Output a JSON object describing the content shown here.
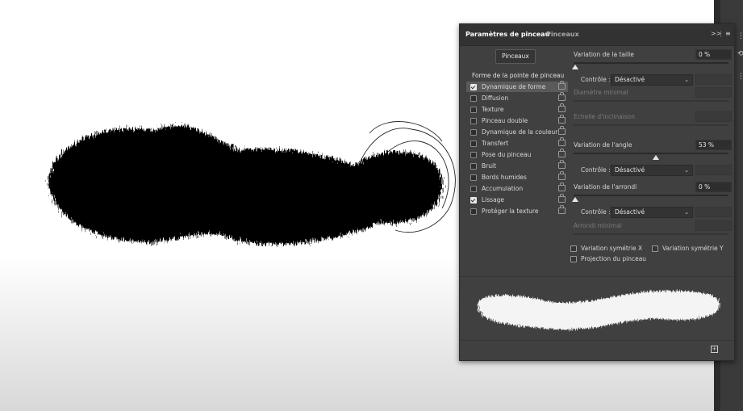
{
  "panel": {
    "tabs": [
      "Paramètres de pinceau",
      "Pinceaux"
    ],
    "menu_expand": ">>",
    "menu_icon": "hamburger-menu-icon",
    "pinceaux_button": "Pinceaux",
    "section_title": "Forme de la pointe de pinceau",
    "options": [
      {
        "label": "Dynamique de forme",
        "checked": true,
        "selected": true
      },
      {
        "label": "Diffusion",
        "checked": false
      },
      {
        "label": "Texture",
        "checked": false
      },
      {
        "label": "Pinceau double",
        "checked": false
      },
      {
        "label": "Dynamique de la couleur",
        "checked": false
      },
      {
        "label": "Transfert",
        "checked": false
      },
      {
        "label": "Pose du pinceau",
        "checked": false
      },
      {
        "label": "Bruit",
        "checked": false
      },
      {
        "label": "Bords humides",
        "checked": false
      },
      {
        "label": "Accumulation",
        "checked": false
      },
      {
        "label": "Lissage",
        "checked": true
      },
      {
        "label": "Protéger la texture",
        "checked": false
      }
    ],
    "settings": {
      "size_jitter": {
        "label": "Variation de la taille",
        "value": "0 %",
        "level": 0
      },
      "control_label": "Contrôle :",
      "control_size": "Désactivé",
      "min_diameter": "Diamètre minimal",
      "tilt_scale": "Echelle d'inclinaison",
      "angle_jitter": {
        "label": "Variation de l'angle",
        "value": "53 %",
        "level": 0.53
      },
      "control_angle": "Désactivé",
      "roundness_jitter": {
        "label": "Variation de l'arrondi",
        "value": "0 %",
        "level": 0
      },
      "control_roundness": "Désactivé",
      "min_roundness": "Arrondi minimal",
      "flip_x": "Variation symétrie X",
      "flip_y": "Variation symétrie Y",
      "brush_projection": "Projection du pinceau"
    },
    "new_brush_icon": "new-brush-icon"
  }
}
